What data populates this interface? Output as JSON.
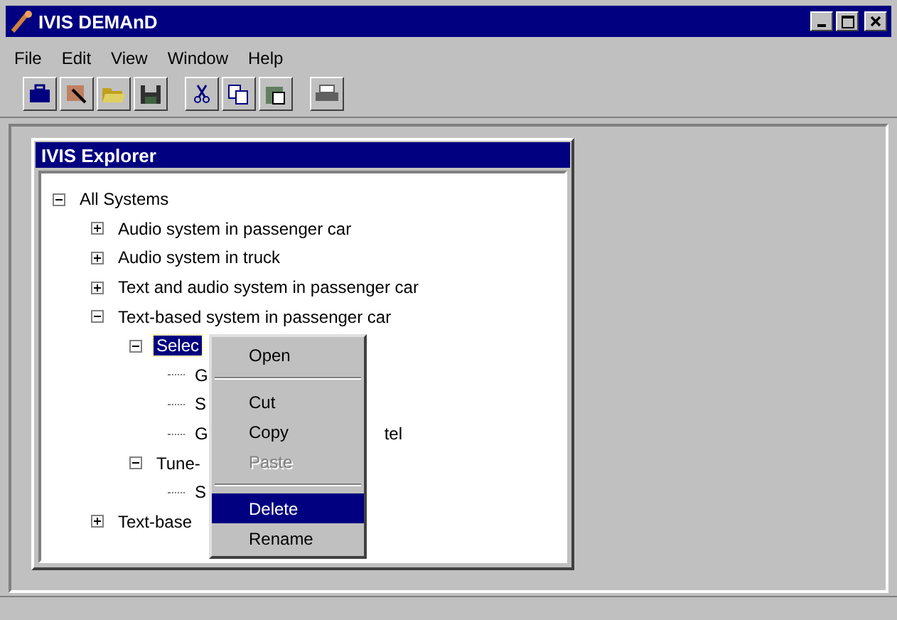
{
  "window": {
    "title": "IVIS DEMAnD"
  },
  "menu": [
    "File",
    "Edit",
    "View",
    "Window",
    "Help"
  ],
  "toolbar": [
    {
      "kind": "briefcase"
    },
    {
      "kind": "picture"
    },
    {
      "kind": "folder"
    },
    {
      "kind": "save"
    },
    {
      "kind": "gap"
    },
    {
      "kind": "cut"
    },
    {
      "kind": "copy"
    },
    {
      "kind": "paste"
    },
    {
      "kind": "gap"
    },
    {
      "kind": "print"
    }
  ],
  "explorer": {
    "title": "IVIS Explorer",
    "tree": [
      {
        "label": "All Systems",
        "expanded": true,
        "selected": false,
        "children": [
          {
            "label": "Audio system in passenger car",
            "expanded": false,
            "selected": false
          },
          {
            "label": "Audio system in truck",
            "expanded": false,
            "selected": false
          },
          {
            "label": "Text and audio system in passenger car",
            "expanded": false,
            "selected": false
          },
          {
            "label": "Text-based system in passenger car",
            "expanded": true,
            "selected": false,
            "children": [
              {
                "label": "Selec",
                "expanded": true,
                "selected": true,
                "children": [
                  {
                    "label": "G",
                    "selected": false
                  },
                  {
                    "label": "S",
                    "selected": false
                  },
                  {
                    "label": "G",
                    "trailing": "tel",
                    "selected": false
                  }
                ]
              },
              {
                "label": "Tune-",
                "expanded": true,
                "selected": false,
                "children": [
                  {
                    "label": "S",
                    "selected": false
                  }
                ]
              }
            ]
          },
          {
            "label": "Text-base",
            "expanded": false,
            "selected": false
          }
        ]
      }
    ]
  },
  "context_menu": [
    {
      "kind": "item",
      "label": "Open",
      "disabled": false,
      "selected": false
    },
    {
      "kind": "separator"
    },
    {
      "kind": "item",
      "label": "Cut",
      "disabled": false,
      "selected": false
    },
    {
      "kind": "item",
      "label": "Copy",
      "disabled": false,
      "selected": false
    },
    {
      "kind": "item",
      "label": "Paste",
      "disabled": true,
      "selected": false
    },
    {
      "kind": "separator"
    },
    {
      "kind": "item",
      "label": "Delete",
      "disabled": false,
      "selected": true
    },
    {
      "kind": "item",
      "label": "Rename",
      "disabled": false,
      "selected": false
    }
  ]
}
